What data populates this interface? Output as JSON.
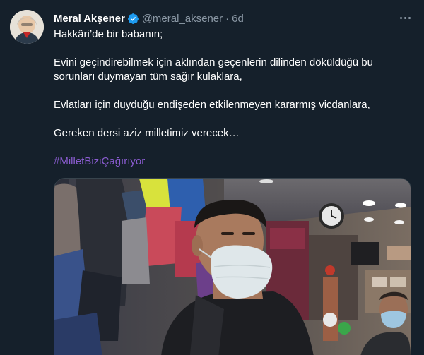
{
  "tweet": {
    "author": {
      "display_name": "Meral Akşener",
      "handle": "@meral_aksener",
      "verified_icon": "verified-badge-icon",
      "avatar_icon": "avatar"
    },
    "separator": "·",
    "timestamp": "6d",
    "more_icon": "more-options-icon",
    "paragraphs": [
      "Hakkâri’de bir babanın;",
      "Evini geçindirebilmek için aklından geçenlerin dilinden döküldüğü bu sorunları duymayan tüm sağır kulaklara,",
      "Evlatları için duyduğu endişeden etkilenmeyen kararmış vicdanlara,",
      "Gereken dersi aziz milletimiz verecek…"
    ],
    "hashtag": "#MilletBiziÇağırıyor",
    "media": "video-thumbnail"
  },
  "colors": {
    "background": "#15202b",
    "text_primary": "#ffffff",
    "text_secondary": "#8b98a5",
    "hashtag": "#8a5cd0",
    "verified": "#1d9bf0",
    "border": "#38444d"
  }
}
